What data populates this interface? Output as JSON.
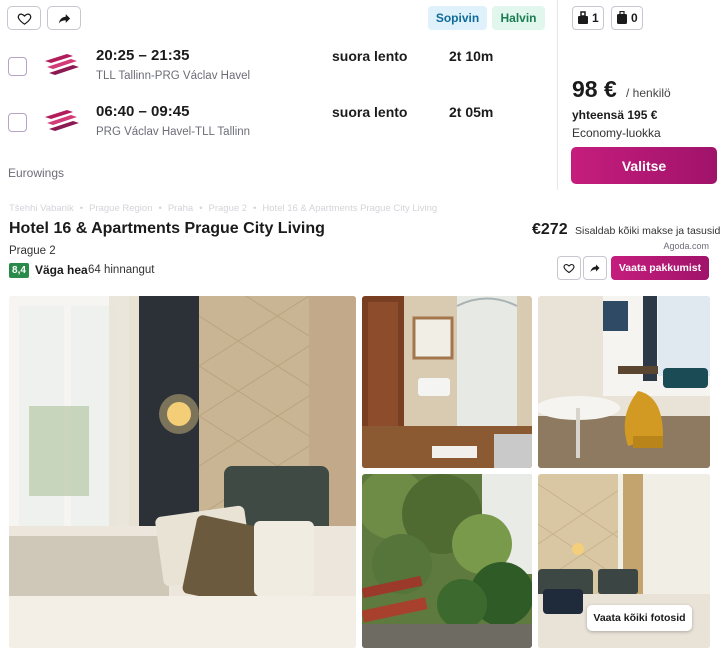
{
  "flight": {
    "tags": {
      "convenient": "Sopivin",
      "cheapest": "Halvin"
    },
    "outbound": {
      "times": "20:25 – 21:35",
      "route": "TLL Tallinn-PRG Václav Havel",
      "stops": "suora lento",
      "duration": "2t 10m"
    },
    "inbound": {
      "times": "06:40 – 09:45",
      "route": "PRG Václav Havel-TLL Tallinn",
      "stops": "suora lento",
      "duration": "2t 05m"
    },
    "airline": "Eurowings",
    "bags": {
      "personal": "1",
      "cabin": "0"
    },
    "price": {
      "amount": "98 €",
      "per": "/ henkilö",
      "total": "yhteensä 195 €",
      "class": "Economy-luokka"
    },
    "select_label": "Valitse"
  },
  "breadcrumb": [
    "Tšehhi Vabariik",
    "Prague Region",
    "Praha",
    "Prague 2",
    "Hotel 16 & Apartments Prague City Living"
  ],
  "hotel": {
    "name": "Hotel 16 & Apartments Prague City Living",
    "city": "Prague 2",
    "rating_score": "8,4",
    "rating_word": "Väga hea",
    "rating_count": "64 hinnangut",
    "price": "€272",
    "price_note": "Sisaldab kõiki makse ja tasusid",
    "provider": "Agoda.com",
    "offer_label": "Vaata pakkumist",
    "all_photos_label": "Vaata kõiki fotosid"
  },
  "colors": {
    "accent": "#c51d7d",
    "rating": "#2a8a4a"
  }
}
